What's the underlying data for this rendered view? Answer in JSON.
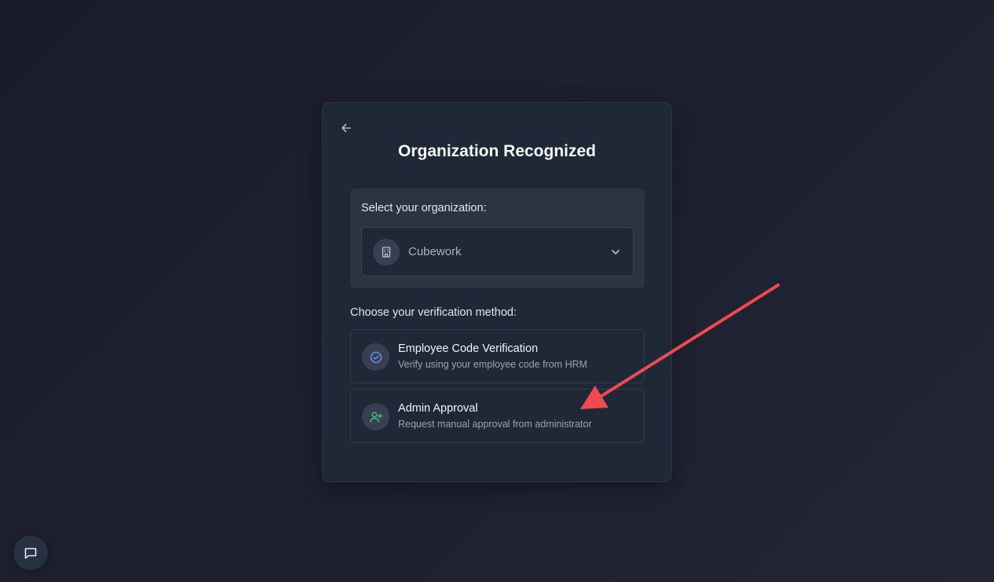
{
  "card": {
    "title": "Organization Recognized"
  },
  "organization": {
    "label": "Select your organization:",
    "selected": "Cubework"
  },
  "verification": {
    "label": "Choose your verification method:",
    "methods": [
      {
        "title": "Employee Code Verification",
        "description": "Verify using your employee code from HRM",
        "icon": "check-circle-icon"
      },
      {
        "title": "Admin Approval",
        "description": "Request manual approval from administrator",
        "icon": "user-plus-icon"
      }
    ]
  },
  "colors": {
    "accent_blue": "#6b8fd6",
    "accent_green": "#3fbf7a",
    "annotation_red": "#ef4a4f"
  }
}
